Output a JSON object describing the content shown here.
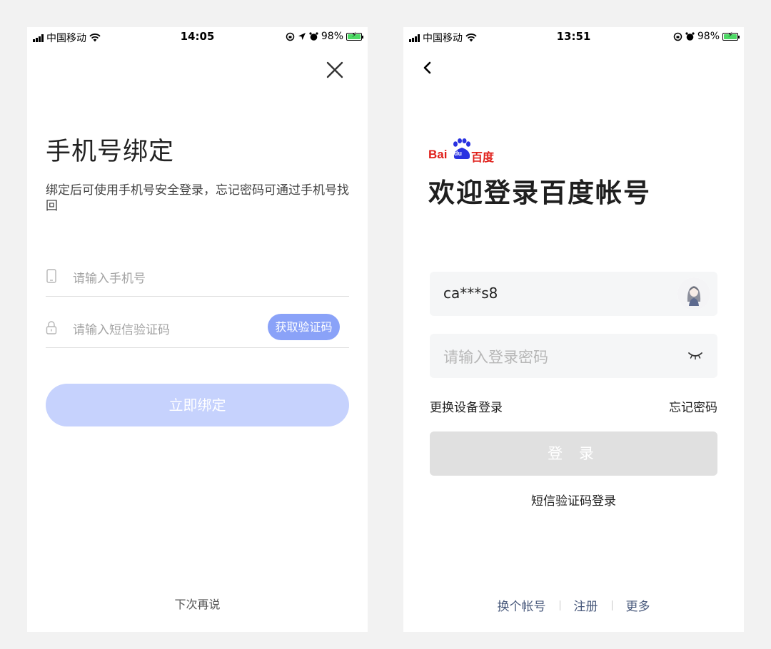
{
  "left_screen": {
    "status": {
      "carrier": "中国移动",
      "time": "14:05",
      "battery": "98%",
      "battery_level": 0.98
    },
    "title": "手机号绑定",
    "subtitle": "绑定后可使用手机号安全登录，忘记密码可通过手机号找回",
    "phone_input": {
      "placeholder": "请输入手机号",
      "icon": "phone-icon"
    },
    "sms_input": {
      "placeholder": "请输入短信验证码",
      "icon": "lock-icon"
    },
    "get_code_label": "获取验证码",
    "bind_button_label": "立即绑定",
    "later_label": "下次再说",
    "colors": {
      "accent": "#8aa2f8",
      "button_disabled": "#c6d2fd"
    }
  },
  "right_screen": {
    "status": {
      "carrier": "中国移动",
      "time": "13:51",
      "battery": "98%",
      "battery_level": 0.98
    },
    "logo": {
      "latin": "Bai",
      "du": "du",
      "chinese": "百度"
    },
    "title": "欢迎登录百度帐号",
    "account_value": "ca***s8",
    "password_placeholder": "请输入登录密码",
    "switch_device_label": "更换设备登录",
    "forgot_password_label": "忘记密码",
    "login_button_label": "登 录",
    "sms_login_label": "短信验证码登录",
    "bottom_links": [
      "换个帐号",
      "注册",
      "更多"
    ],
    "colors": {
      "logo_red": "#e0201b",
      "logo_blue": "#2932e1",
      "link": "#46577a"
    }
  }
}
